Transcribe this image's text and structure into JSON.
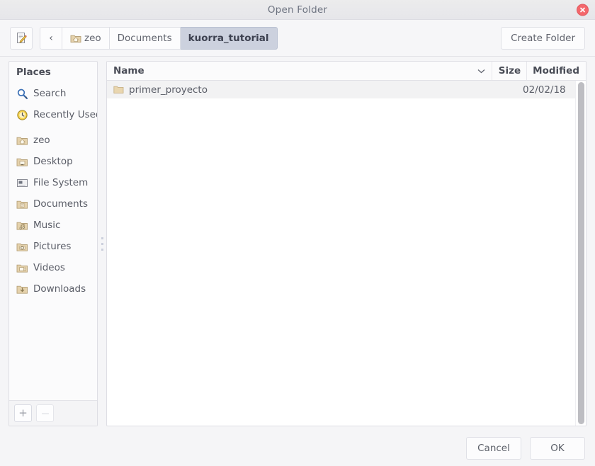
{
  "window": {
    "title": "Open Folder",
    "close_icon": "close-icon"
  },
  "toolbar": {
    "type_filename_icon": "document-pencil-icon",
    "back_label": "‹",
    "create_folder_label": "Create Folder",
    "path_buttons": [
      {
        "label": "zeo",
        "icon": "home-folder-icon",
        "active": false
      },
      {
        "label": "Documents",
        "icon": "",
        "active": false
      },
      {
        "label": "kuorra_tutorial",
        "icon": "",
        "active": true
      }
    ]
  },
  "sidebar": {
    "header": "Places",
    "items": [
      {
        "label": "Search",
        "icon": "search-icon"
      },
      {
        "label": "Recently Used",
        "icon": "recent-clock-icon"
      },
      {
        "label": "zeo",
        "icon": "home-folder-icon"
      },
      {
        "label": "Desktop",
        "icon": "desktop-folder-icon"
      },
      {
        "label": "File System",
        "icon": "drive-icon"
      },
      {
        "label": "Documents",
        "icon": "documents-folder-icon"
      },
      {
        "label": "Music",
        "icon": "music-folder-icon"
      },
      {
        "label": "Pictures",
        "icon": "pictures-folder-icon"
      },
      {
        "label": "Videos",
        "icon": "videos-folder-icon"
      },
      {
        "label": "Downloads",
        "icon": "downloads-folder-icon"
      }
    ],
    "add_bookmark_label": "+",
    "remove_bookmark_label": "—"
  },
  "filelist": {
    "columns": {
      "name": "Name",
      "size": "Size",
      "modified": "Modified",
      "sort_indicator": "⌄"
    },
    "rows": [
      {
        "name": "primer_proyecto",
        "size": "",
        "modified": "02/02/18",
        "icon": "folder-icon"
      }
    ]
  },
  "actions": {
    "cancel_label": "Cancel",
    "ok_label": "OK"
  },
  "colors": {
    "titlebar_bg": "#e8e8ec",
    "toolbar_bg": "#f6f6f8",
    "active_path_bg": "#ccd1de",
    "close_btn": "#f4676b",
    "folder": "#e8d3a9",
    "text": "#5a5d67"
  }
}
